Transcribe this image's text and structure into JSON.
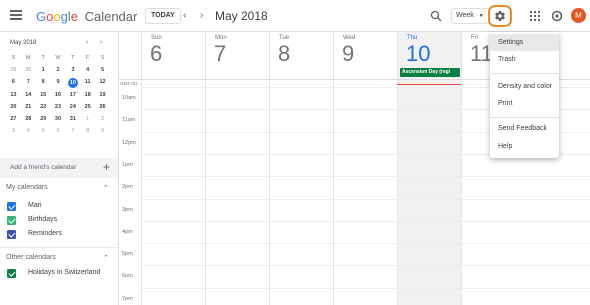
{
  "app": {
    "logo_letters": [
      "G",
      "o",
      "o",
      "g",
      "l",
      "e"
    ],
    "product": "Calendar"
  },
  "toolbar": {
    "today_label": "TODAY",
    "prev_icon": "chevron-left-icon",
    "next_icon": "chevron-right-icon",
    "month_title": "May 2018",
    "view_label": "Week",
    "settings_icon": "gear-icon",
    "avatar_letter": "M",
    "avatar_color": "#e8541f",
    "highlight_color": "#f08a24"
  },
  "mini_calendar": {
    "title": "May 2018",
    "weekday_headers": [
      "S",
      "M",
      "T",
      "W",
      "T",
      "F",
      "S"
    ],
    "weeks": [
      [
        "29",
        "30",
        "1",
        "2",
        "3",
        "4",
        "5"
      ],
      [
        "6",
        "7",
        "8",
        "9",
        "10",
        "11",
        "12"
      ],
      [
        "13",
        "14",
        "15",
        "16",
        "17",
        "18",
        "19"
      ],
      [
        "20",
        "21",
        "22",
        "23",
        "24",
        "25",
        "26"
      ],
      [
        "27",
        "28",
        "29",
        "30",
        "31",
        "1",
        "2"
      ],
      [
        "3",
        "4",
        "5",
        "6",
        "7",
        "8",
        "9"
      ]
    ],
    "today": "10"
  },
  "sidebar": {
    "add_friend_placeholder": "Add a friend's calendar",
    "my_calendars_title": "My calendars",
    "my_calendars": [
      {
        "label": "Mari",
        "color": "#1a73e8"
      },
      {
        "label": "Birthdays",
        "color": "#33b679"
      },
      {
        "label": "Reminders",
        "color": "#3f51b5"
      }
    ],
    "other_calendars_title": "Other calendars",
    "other_calendars": [
      {
        "label": "Holidays in Switzerland",
        "color": "#0b8043"
      }
    ]
  },
  "week": {
    "days": [
      {
        "name": "Sun",
        "num": "6"
      },
      {
        "name": "Mon",
        "num": "7"
      },
      {
        "name": "Tue",
        "num": "8"
      },
      {
        "name": "Wed",
        "num": "9"
      },
      {
        "name": "Thu",
        "num": "10"
      },
      {
        "name": "Fri",
        "num": "11"
      }
    ],
    "today_index": 4,
    "allday_event": {
      "label": "Ascension Day (regi",
      "color": "#0b8043"
    },
    "timezone": "GMT+02",
    "hours": [
      "10am",
      "11am",
      "12pm",
      "1pm",
      "2pm",
      "3pm",
      "4pm",
      "5pm",
      "6pm",
      "7pm"
    ]
  },
  "settings_menu": {
    "items": [
      "Settings",
      "Trash",
      "Density and color",
      "Print",
      "Send Feedback",
      "Help"
    ]
  }
}
